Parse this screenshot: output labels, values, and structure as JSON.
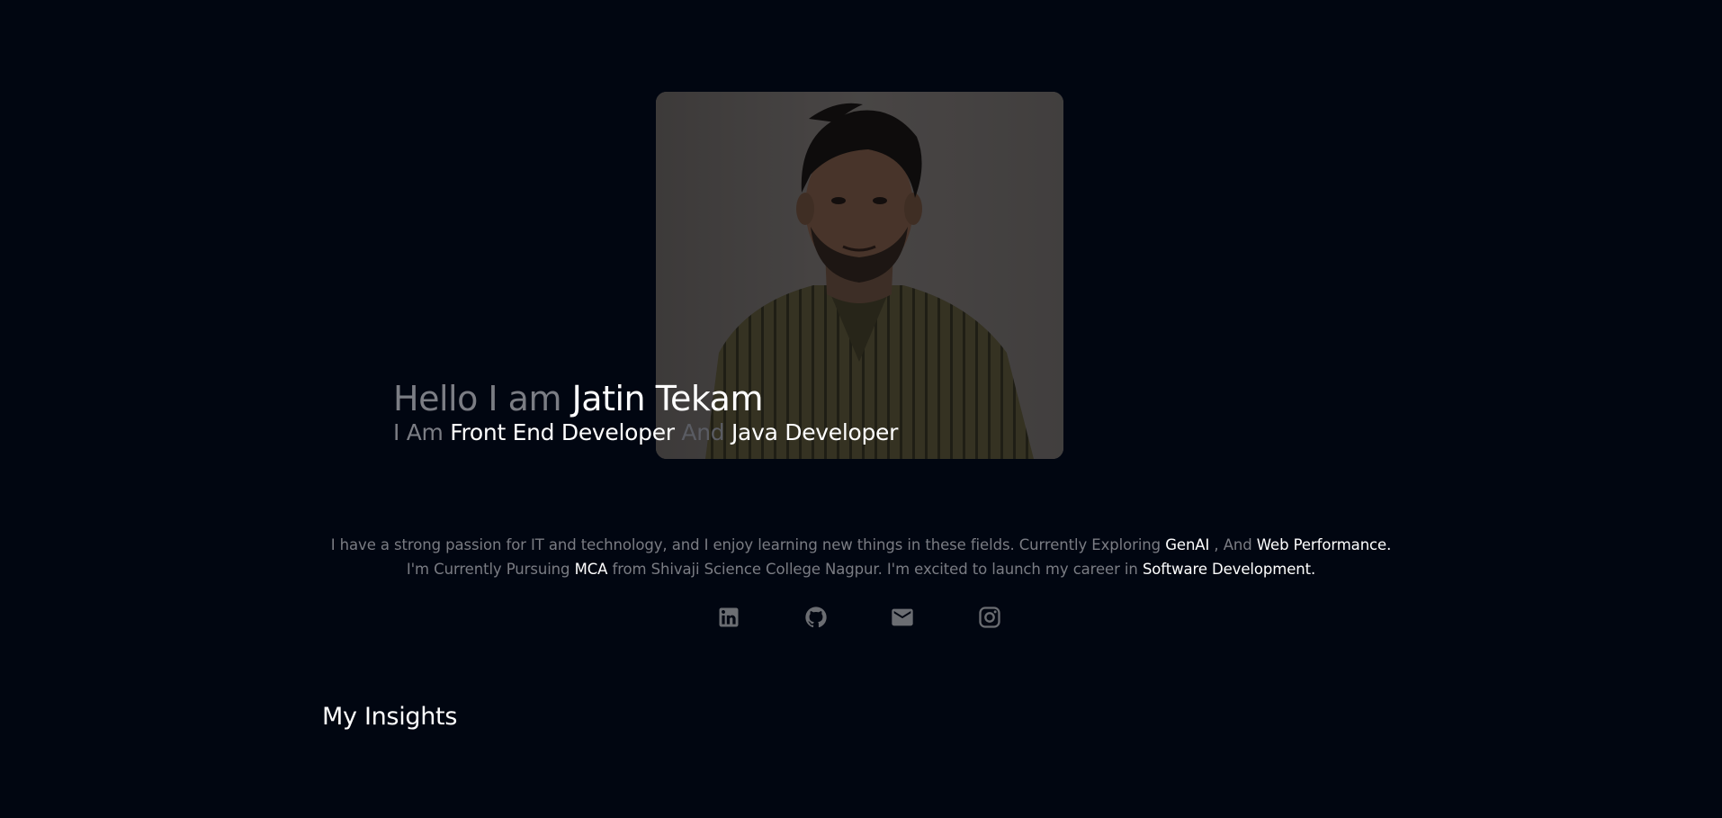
{
  "hero": {
    "greeting_prefix": "Hello I am",
    "name": "Jatin Tekam",
    "role_prefix": "I Am",
    "role_1": "Front End Developer",
    "role_joiner": "And",
    "role_2": "Java Developer",
    "photo_icon": "portrait-photo"
  },
  "about": {
    "line1_a": "I have a strong passion for IT and technology, and I enjoy learning new things in these fields. Currently Exploring",
    "line1_hl1": "GenAI",
    "line1_b": ", And",
    "line1_hl2": "Web Performance.",
    "line2_a": "I'm Currently Pursuing",
    "line2_hl1": "MCA",
    "line2_b": "from Shivaji Science College Nagpur. I'm excited to launch my career in",
    "line2_hl2": "Software Development."
  },
  "socials": [
    {
      "icon": "linkedin-icon"
    },
    {
      "icon": "github-icon"
    },
    {
      "icon": "mail-icon"
    },
    {
      "icon": "instagram-icon"
    }
  ],
  "insights": {
    "title": "My Insights"
  },
  "colors": {
    "background": "#010611",
    "text_bright": "#ffffff",
    "text_dim": "#7b7d84",
    "icon": "#6b6d72"
  }
}
